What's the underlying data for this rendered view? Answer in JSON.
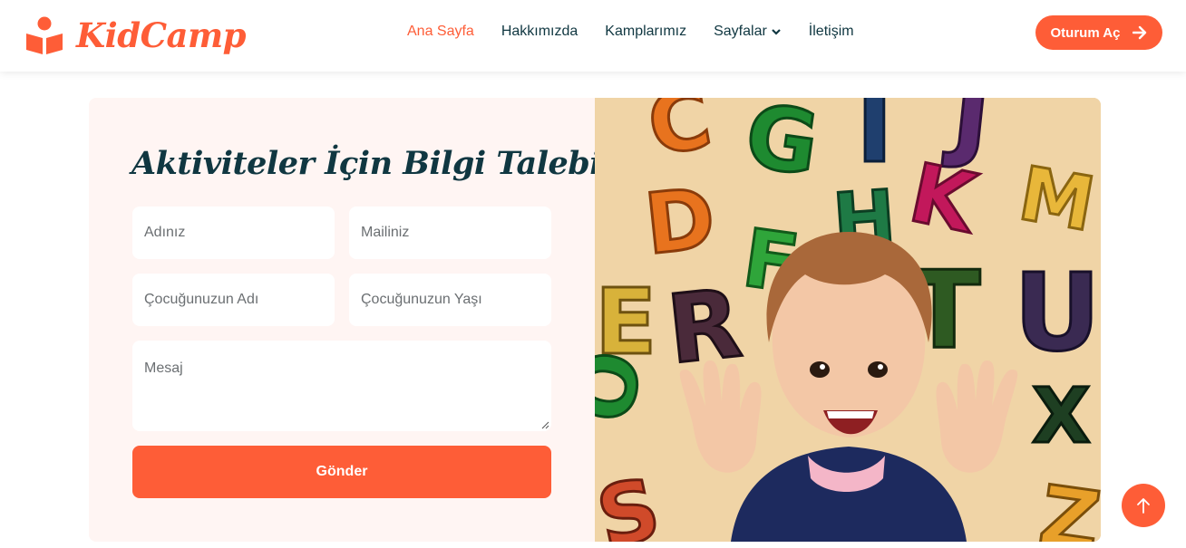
{
  "brand": {
    "name": "KidCamp",
    "icon": "reading-child-icon",
    "color": "#FE5D37"
  },
  "nav": {
    "items": [
      {
        "label": "Ana Sayfa",
        "active": true
      },
      {
        "label": "Hakkımızda"
      },
      {
        "label": "Kamplarımız"
      },
      {
        "label": "Sayfalar",
        "icon": "chevron-down-icon"
      },
      {
        "label": "İletişim"
      }
    ],
    "login_label": "Oturum Aç",
    "login_icon": "arrow-right-icon"
  },
  "form": {
    "title": "Aktiviteler İçin Bilgi Talebi",
    "name_placeholder": "Adınız",
    "email_placeholder": "Mailiniz",
    "child_name_placeholder": "Çocuğunuzun Adı",
    "child_age_placeholder": "Çocuğunuzun Yaşı",
    "message_placeholder": "Mesaj",
    "submit_label": "Gönder"
  },
  "back_to_top_icon": "arrow-up-icon",
  "colors": {
    "primary": "#FE5D37",
    "dark": "#103741",
    "form_bg": "#FFF5F3"
  }
}
